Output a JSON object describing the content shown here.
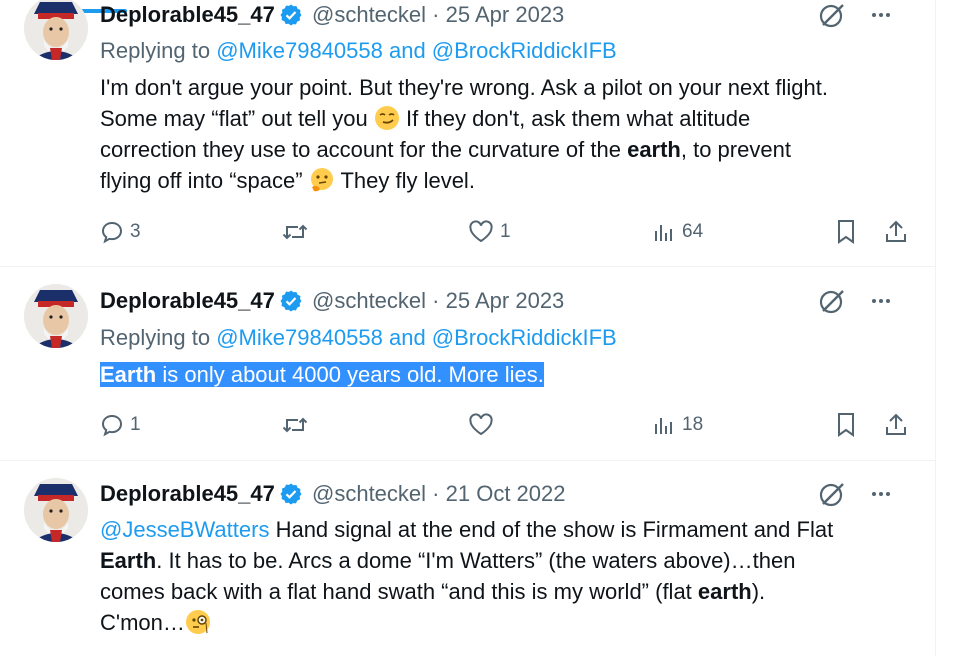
{
  "tweets": [
    {
      "name": "Deplorable45_47",
      "handle": "@schteckel",
      "sep": "·",
      "date": "25 Apr 2023",
      "replying_prefix": "Replying to",
      "replying_to": "@Mike79840558 and @BrockRiddickIFB",
      "body_lines": [
        "I'm don't argue your point. But they're wrong. Ask a pilot on your next flight.",
        "Some may “flat” out tell you",
        "If they don't, ask them what altitude",
        "correction they use to account for the curvature of the",
        "earth",
        ", to prevent",
        "flying off into “space”",
        "They fly level."
      ],
      "stats": {
        "replies": "3",
        "retweets": "",
        "likes": "1",
        "views": "64"
      }
    },
    {
      "name": "Deplorable45_47",
      "handle": "@schteckel",
      "sep": "·",
      "date": "25 Apr 2023",
      "replying_prefix": "Replying to",
      "replying_to": "@Mike79840558 and @BrockRiddickIFB",
      "body_bold": "Earth",
      "body_rest": " is only about 4000 years old. More lies.",
      "stats": {
        "replies": "1",
        "retweets": "",
        "likes": "",
        "views": "18"
      }
    },
    {
      "name": "Deplorable45_47",
      "handle": "@schteckel",
      "sep": "·",
      "date": "21 Oct 2022",
      "mention": "@JesseBWatters",
      "body_parts": [
        " Hand signal at the end of the show is Firmament and Flat",
        "Earth",
        ". It has to be. Arcs a dome “I'm Watters” (the waters above)…then",
        "comes back with a flat hand swath “and this is my world” (flat ",
        "earth",
        ").",
        "C'mon…"
      ]
    }
  ],
  "colors": {
    "accent": "#1d9bf0",
    "text": "#0f1419",
    "muted": "#536471",
    "selection": "#3390ff"
  },
  "icons": [
    "verified-badge-icon",
    "grok-icon",
    "more-icon",
    "reply-icon",
    "retweet-icon",
    "like-icon",
    "views-icon",
    "bookmark-icon",
    "share-icon",
    "smirk-emoji",
    "thinking-emoji",
    "monocle-emoji"
  ]
}
